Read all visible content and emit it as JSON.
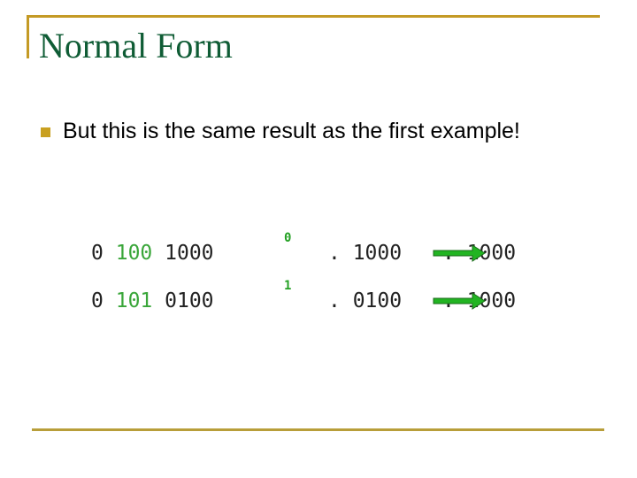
{
  "slide": {
    "title": "Normal Form",
    "bullets": [
      {
        "icon": "square-bullet-icon",
        "text": "But this is the same result as the first example!"
      }
    ],
    "rows": [
      {
        "sign": "0",
        "exponent": "100",
        "mantissa": "1000",
        "bit": "0",
        "fraction": ". 1000",
        "normalized": ". 1000"
      },
      {
        "sign": "0",
        "exponent": "101",
        "mantissa": "0100",
        "bit": "1",
        "fraction": ". 0100",
        "normalized": ". 1000"
      }
    ],
    "colors": {
      "title": "#0f5c35",
      "rule": "#c49a25",
      "exponent": "#3aa63a",
      "arrow": "#22b422"
    }
  }
}
